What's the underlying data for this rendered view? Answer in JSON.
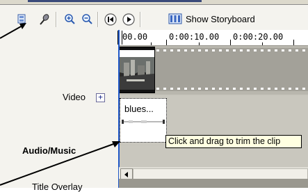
{
  "toolbar": {
    "buttons": [
      "narrate-icon",
      "set-audio-levels-icon",
      "zoom-in-icon",
      "zoom-out-icon",
      "rewind-icon",
      "play-icon",
      "storyboard-icon"
    ],
    "storyboard_label": "Show Storyboard"
  },
  "timeline": {
    "ticks": [
      "00.00",
      "0:00:10.00",
      "0:00:20.00"
    ]
  },
  "tracks": {
    "video": "Video",
    "video_expand": "+",
    "audio": "Audio/Music",
    "title": "Title Overlay"
  },
  "audio_clip": {
    "label": "blues..."
  },
  "tooltip": {
    "text": "Click and drag to trim the clip"
  },
  "colors": {
    "playhead": "#1f57c7",
    "tooltip_bg": "#ffffe1",
    "toolbar_bg": "#f4f3ee",
    "arrow": "#000000"
  }
}
